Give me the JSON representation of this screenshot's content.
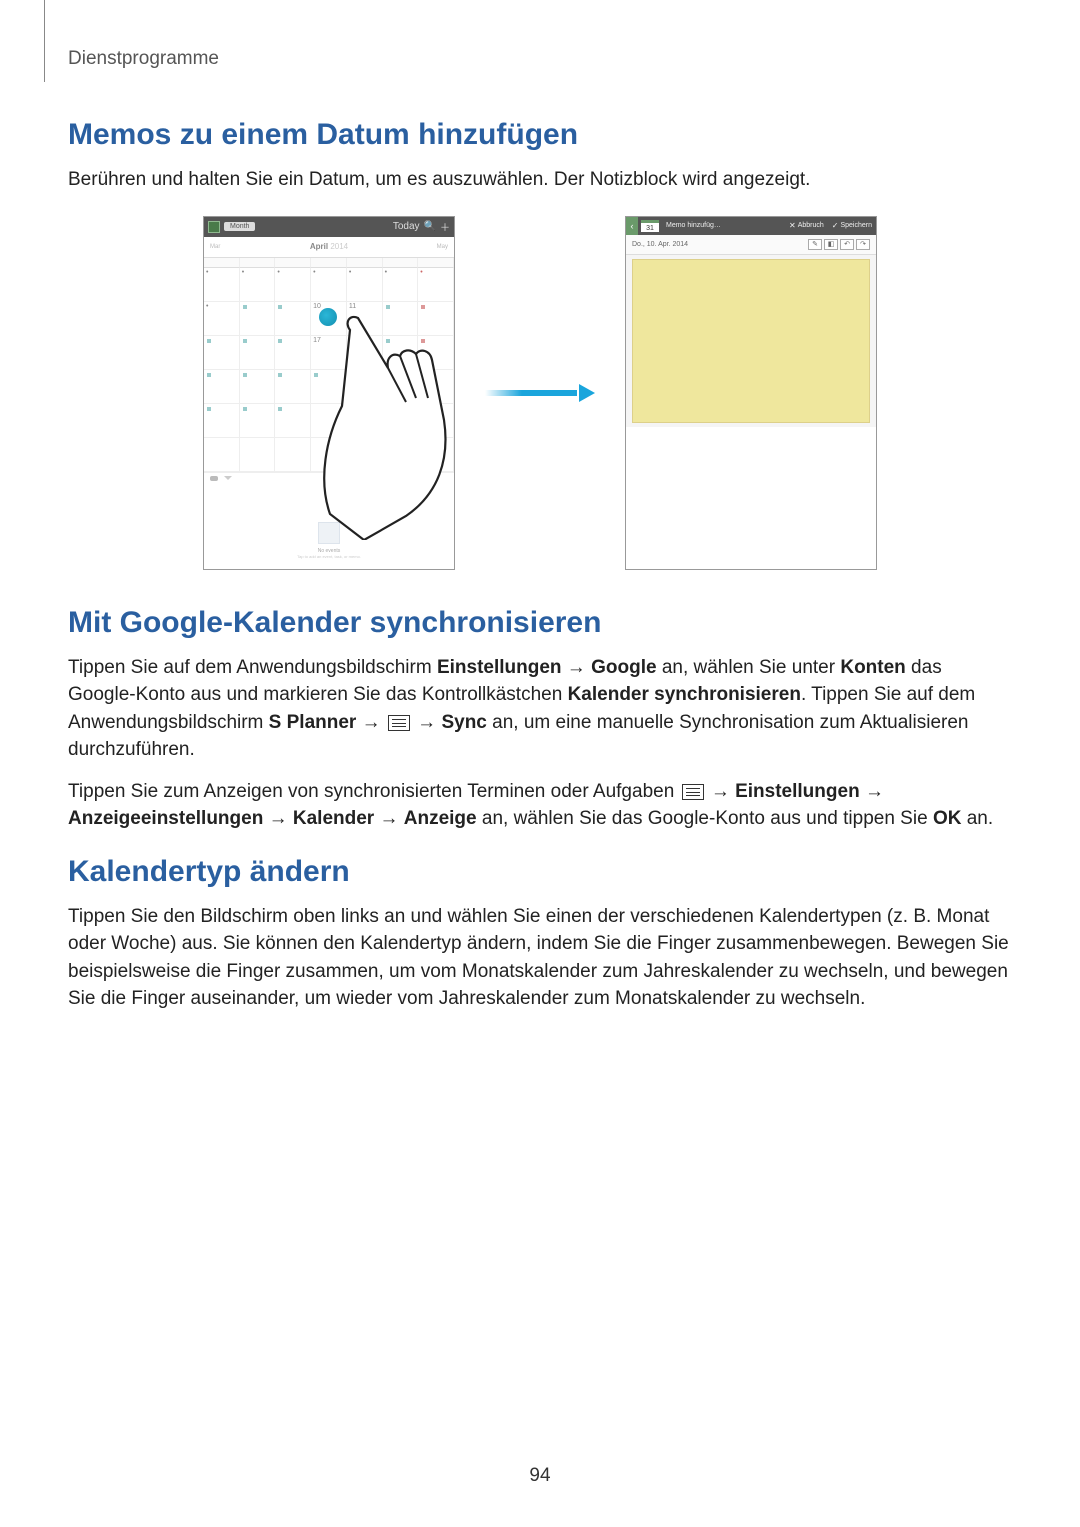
{
  "breadcrumb": "Dienstprogramme",
  "page_number": "94",
  "section1": {
    "heading": "Memos zu einem Datum hinzufügen",
    "intro": "Berühren und halten Sie ein Datum, um es auszuwählen. Der Notizblock wird angezeigt."
  },
  "figure": {
    "calendar": {
      "month_label": "Month",
      "title_month": "April",
      "title_year": "2014",
      "today_label": "Today",
      "nav_prev": "Mar",
      "nav_next": "May",
      "highlight_day": "10",
      "adjacent_day": "11",
      "next_row_day": "17",
      "empty_hint_title": "No events",
      "empty_hint_sub": "Tap to add an event, task, or memo."
    },
    "memo": {
      "date_icon": "31",
      "title": "Memo hinzufüg…",
      "cancel": "Abbruch",
      "save": "Speichern",
      "date_line": "Do., 10. Apr. 2014"
    }
  },
  "section2": {
    "heading": "Mit Google-Kalender synchronisieren",
    "p1_a": "Tippen Sie auf dem Anwendungsbildschirm ",
    "p1_b_bold": "Einstellungen",
    "p1_c": " → ",
    "p1_d_bold": "Google",
    "p1_e": " an, wählen Sie unter ",
    "p1_f_bold": "Konten",
    "p1_g": " das Google-Konto aus und markieren Sie das Kontrollkästchen ",
    "p1_h_bold": "Kalender synchronisieren",
    "p1_i": ". Tippen Sie auf dem Anwendungsbildschirm ",
    "p1_j_bold": "S Planner",
    "p1_k": " → ",
    "p1_l": " → ",
    "p1_m_bold": "Sync",
    "p1_n": " an, um eine manuelle Synchronisation zum Aktualisieren durchzuführen.",
    "p2_a": "Tippen Sie zum Anzeigen von synchronisierten Terminen oder Aufgaben ",
    "p2_b": " → ",
    "p2_c_bold": "Einstellungen",
    "p2_d": " → ",
    "p2_e_bold": "Anzeigeeinstellungen",
    "p2_f": " → ",
    "p2_g_bold": "Kalender",
    "p2_h": " → ",
    "p2_i_bold": "Anzeige",
    "p2_j": " an, wählen Sie das Google-Konto aus und tippen Sie ",
    "p2_k_bold": "OK",
    "p2_l": " an."
  },
  "section3": {
    "heading": "Kalendertyp ändern",
    "body": "Tippen Sie den Bildschirm oben links an und wählen Sie einen der verschiedenen Kalendertypen (z. B. Monat oder Woche) aus. Sie können den Kalendertyp ändern, indem Sie die Finger zusammenbewegen. Bewegen Sie beispielsweise die Finger zusammen, um vom Monatskalender zum Jahreskalender zu wechseln, und bewegen Sie die Finger auseinander, um wieder vom Jahreskalender zum Monatskalender zu wechseln."
  }
}
